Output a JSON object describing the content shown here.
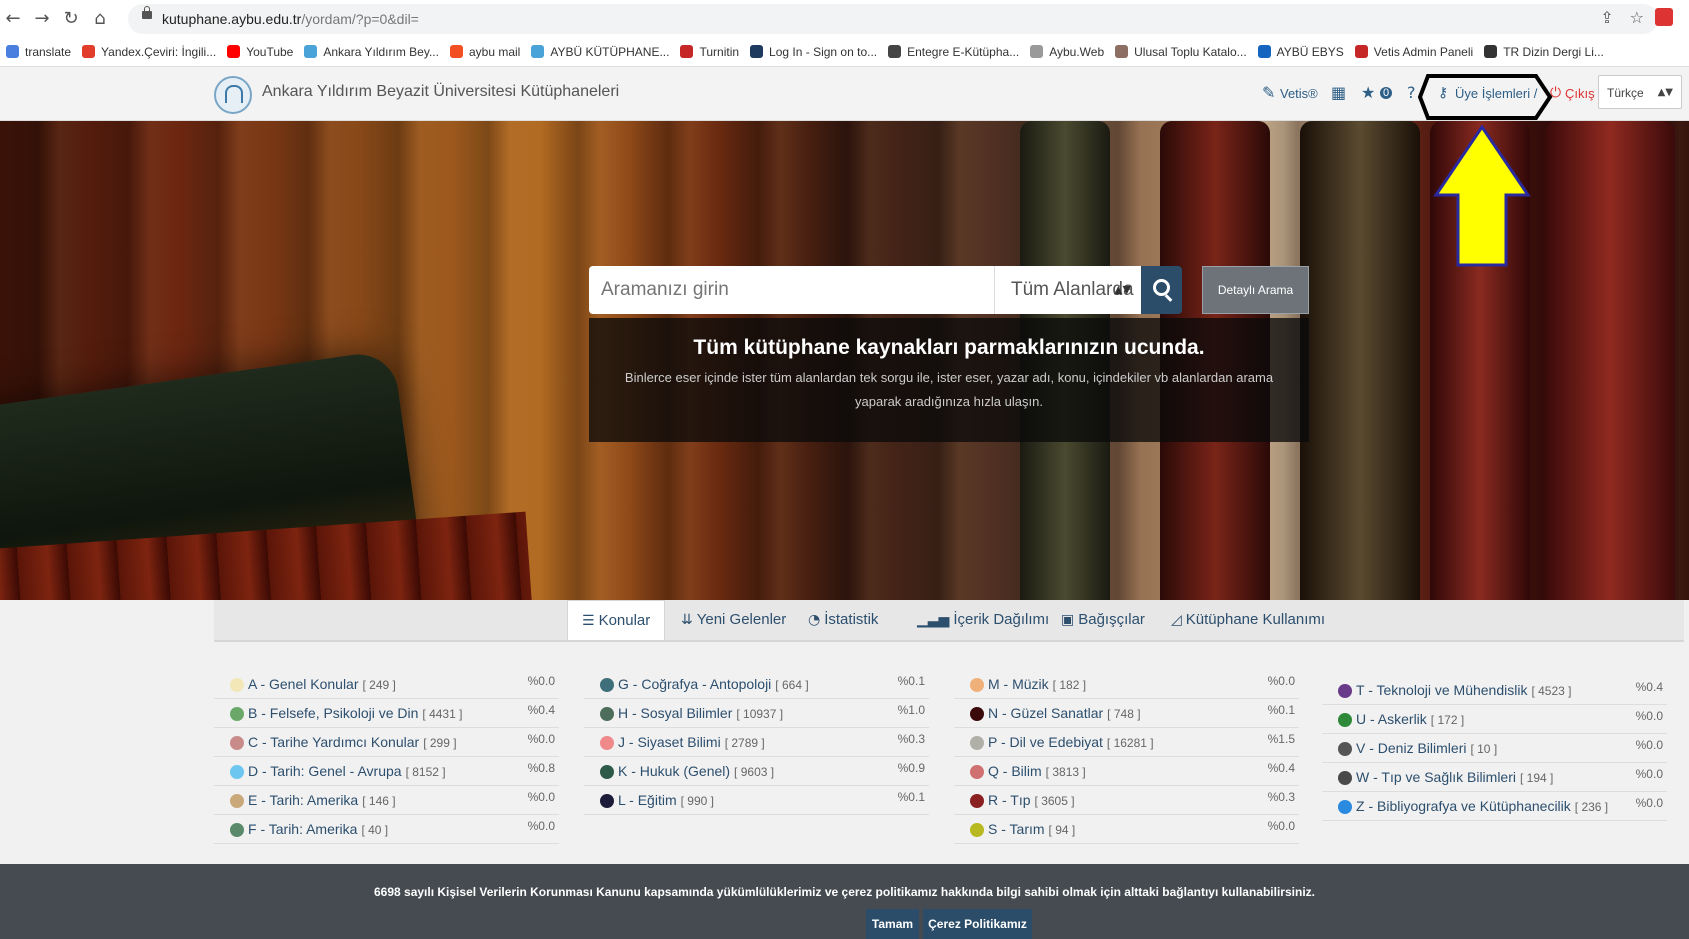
{
  "browser": {
    "url_host": "kutuphane.aybu.edu.tr",
    "url_path": "/yordam/?p=0&dil=",
    "bookmarks": [
      {
        "label": "translate",
        "color": "#4a7fe0"
      },
      {
        "label": "Yandex.Çeviri: İngili...",
        "color": "#e23d2a"
      },
      {
        "label": "YouTube",
        "color": "#ff0000"
      },
      {
        "label": "Ankara Yıldırım Bey...",
        "color": "#4aa3d8"
      },
      {
        "label": "aybu mail",
        "color": "#f25022"
      },
      {
        "label": "AYBÜ KÜTÜPHANE...",
        "color": "#4aa3d8"
      },
      {
        "label": "Turnitin",
        "color": "#c62828"
      },
      {
        "label": "Log In - Sign on to...",
        "color": "#1e3a5f"
      },
      {
        "label": "Entegre E-Kütüpha...",
        "color": "#444444"
      },
      {
        "label": "Aybu.Web",
        "color": "#999999"
      },
      {
        "label": "Ulusal Toplu Katalo...",
        "color": "#8d6e63"
      },
      {
        "label": "AYBÜ EBYS",
        "color": "#1565c0"
      },
      {
        "label": "Vetis Admin Paneli",
        "color": "#c62828"
      },
      {
        "label": "TR Dizin Dergi Li...",
        "color": "#333333"
      }
    ]
  },
  "header": {
    "site_title": "Ankara Yıldırım Beyazit Üniversitesi Kütüphaneleri",
    "vetis": "Vetis®",
    "fav_count": "0",
    "uye": "Üye İşlemleri /",
    "cikis": "Çıkış",
    "language": "Türkçe"
  },
  "search": {
    "placeholder": "Aramanızı girin",
    "scope": "Tüm Alanlarda",
    "detail_label": "Detaylı Arama"
  },
  "hero": {
    "heading": "Tüm kütüphane kaynakları parmaklarınızın ucunda.",
    "text": "Binlerce eser içinde ister tüm alanlardan tek sorgu ile, ister eser, yazar adı, konu, içindekiler vb alanlardan arama yaparak aradığınıza hızla ulaşın."
  },
  "tabs": [
    "Konular",
    "Yeni Gelenler",
    "İstatistik",
    "İçerik Dağılımı",
    "Bağışçılar",
    "Kütüphane Kullanımı"
  ],
  "subjects": [
    [
      {
        "label": "A - Genel Konular",
        "count": "[ 249 ]",
        "pct": "%0.0",
        "color": "#f3e7b8"
      },
      {
        "label": "B - Felsefe, Psikoloji ve Din",
        "count": "[ 4431 ]",
        "pct": "%0.4",
        "color": "#6aa86a"
      },
      {
        "label": "C - Tarihe Yardımcı Konular",
        "count": "[ 299 ]",
        "pct": "%0.0",
        "color": "#c98a8a"
      },
      {
        "label": "D - Tarih: Genel - Avrupa",
        "count": "[ 8152 ]",
        "pct": "%0.8",
        "color": "#6cc6f0"
      },
      {
        "label": "E - Tarih: Amerika",
        "count": "[ 146 ]",
        "pct": "%0.0",
        "color": "#c9a87a"
      },
      {
        "label": "F - Tarih: Amerika",
        "count": "[ 40 ]",
        "pct": "%0.0",
        "color": "#5a8a6a"
      }
    ],
    [
      {
        "label": "G - Coğrafya - Antopoloji",
        "count": "[ 664 ]",
        "pct": "%0.1",
        "color": "#3f6f7a"
      },
      {
        "label": "H - Sosyal Bilimler",
        "count": "[ 10937 ]",
        "pct": "%1.0",
        "color": "#4d6e5a"
      },
      {
        "label": "J - Siyaset Bilimi",
        "count": "[ 2789 ]",
        "pct": "%0.3",
        "color": "#f08a8a"
      },
      {
        "label": "K - Hukuk (Genel)",
        "count": "[ 9603 ]",
        "pct": "%0.9",
        "color": "#2e5a4a"
      },
      {
        "label": "L - Eğitim",
        "count": "[ 990 ]",
        "pct": "%0.1",
        "color": "#1c1c3a"
      }
    ],
    [
      {
        "label": "M - Müzik",
        "count": "[ 182 ]",
        "pct": "%0.0",
        "color": "#f0b07a"
      },
      {
        "label": "N - Güzel Sanatlar",
        "count": "[ 748 ]",
        "pct": "%0.1",
        "color": "#3a0a0a"
      },
      {
        "label": "P - Dil ve Edebiyat",
        "count": "[ 16281 ]",
        "pct": "%1.5",
        "color": "#b0b0a8"
      },
      {
        "label": "Q - Bilim",
        "count": "[ 3813 ]",
        "pct": "%0.4",
        "color": "#d07070"
      },
      {
        "label": "R - Tıp",
        "count": "[ 3605 ]",
        "pct": "%0.3",
        "color": "#8a2020"
      },
      {
        "label": "S - Tarım",
        "count": "[ 94 ]",
        "pct": "%0.0",
        "color": "#b8b820"
      }
    ],
    [
      {
        "label": "T - Teknoloji ve Mühendislik",
        "count": "[ 4523 ]",
        "pct": "%0.4",
        "color": "#6a3a8a"
      },
      {
        "label": "U - Askerlik",
        "count": "[ 172 ]",
        "pct": "%0.0",
        "color": "#2e8a3a"
      },
      {
        "label": "V - Deniz Bilimleri",
        "count": "[ 10 ]",
        "pct": "%0.0",
        "color": "#555555"
      },
      {
        "label": "W - Tıp ve Sağlık Bilimleri",
        "count": "[ 194 ]",
        "pct": "%0.0",
        "color": "#4a4a4a"
      },
      {
        "label": "Z - Bibliyografya ve Kütüphanecilik",
        "count": "[ 236 ]",
        "pct": "%0.0",
        "color": "#2a8ae0"
      }
    ]
  ],
  "cookie": {
    "text": "6698 sayılı Kişisel Verilerin Korunması Kanunu kapsamında yükümlülüklerimiz ve çerez politikamız hakkında bilgi sahibi olmak için alttaki bağlantıyı kullanabilirsiniz.",
    "ok": "Tamam",
    "policy": "Çerez Politikamız"
  },
  "colors": {
    "brand": "#2d5e86",
    "search_button": "#2b4d6a",
    "highlight_arrow": "#ffff00",
    "cookie_bar": "#454b50"
  }
}
